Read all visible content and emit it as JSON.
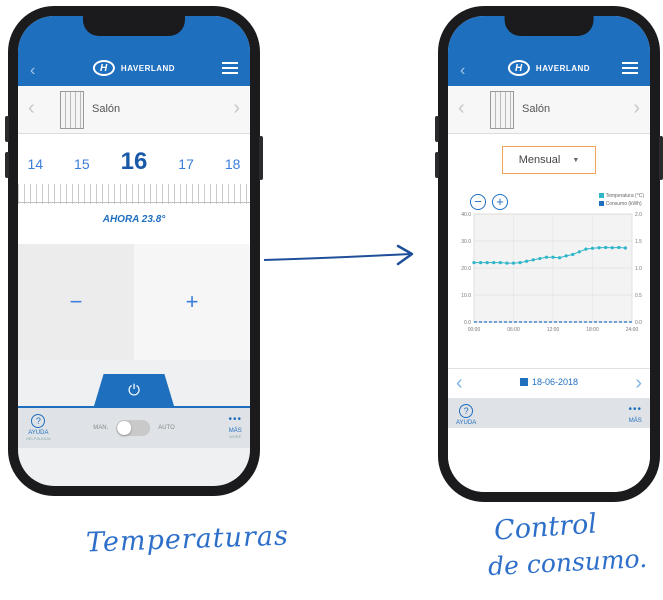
{
  "left_phone": {
    "header": {
      "brand": "HAVERLAND",
      "back_icon": "chevron-left-icon",
      "menu_icon": "hamburger-menu-icon"
    },
    "device": {
      "name": "Salón"
    },
    "temperatures": {
      "t1": "14",
      "t2": "15",
      "current": "16",
      "t4": "17",
      "t5": "18"
    },
    "now_label": "AHORA 23.8°",
    "minus_label": "−",
    "plus_label": "+",
    "power_icon": "power-icon",
    "bottom": {
      "help_label": "AYUDA",
      "help_sub": "HELP/AJUDA",
      "manual_label": "MAN.",
      "auto_label": "AUTO",
      "more_label": "MÁS",
      "more_sub": "MORE"
    }
  },
  "right_phone": {
    "header": {
      "brand": "HAVERLAND"
    },
    "device": {
      "name": "Salón"
    },
    "period": {
      "selected": "Mensual"
    },
    "legend": {
      "temperature": "Temperatura (°C)",
      "consumption": "Consumo (kWh)"
    },
    "date": "18-06-2018",
    "bottom": {
      "help_label": "AYUDA",
      "more_label": "MÁS"
    },
    "colors": {
      "temperature": "#2fb5c9",
      "consumption": "#1f6fbf",
      "accent": "#1f6fbf"
    }
  },
  "chart_data": {
    "type": "line",
    "x_ticks": [
      "00:00",
      "06:00",
      "12:00",
      "18:00",
      "24:00"
    ],
    "y_left_ticks": [
      "0.0",
      "10.0",
      "20.0",
      "30.0",
      "40.0"
    ],
    "y_right_ticks": [
      "0.0",
      "0.5",
      "1.0",
      "1.5",
      "2.0"
    ],
    "ylim_left": [
      0,
      40
    ],
    "ylim_right": [
      0,
      2
    ],
    "xlim": [
      0,
      24
    ],
    "series": [
      {
        "name": "Temperatura (°C)",
        "axis": "left",
        "x": [
          0,
          1,
          2,
          3,
          4,
          5,
          6,
          7,
          8,
          9,
          10,
          11,
          12,
          13,
          14,
          15,
          16,
          17,
          18,
          19,
          20,
          21,
          22,
          23
        ],
        "values": [
          22,
          22,
          22,
          22,
          22,
          21.8,
          21.8,
          22,
          22.5,
          23,
          23.5,
          24,
          24,
          23.8,
          24.5,
          25,
          26,
          27,
          27.3,
          27.5,
          27.6,
          27.5,
          27.6,
          27.4
        ]
      },
      {
        "name": "Consumo (kWh)",
        "axis": "right",
        "x": [
          0,
          24
        ],
        "values": [
          0,
          0
        ]
      }
    ],
    "grid": true,
    "legend_position": "top-right"
  },
  "captions": {
    "left": "Temperaturas",
    "right_line1": "Control",
    "right_line2": "de consumo."
  }
}
